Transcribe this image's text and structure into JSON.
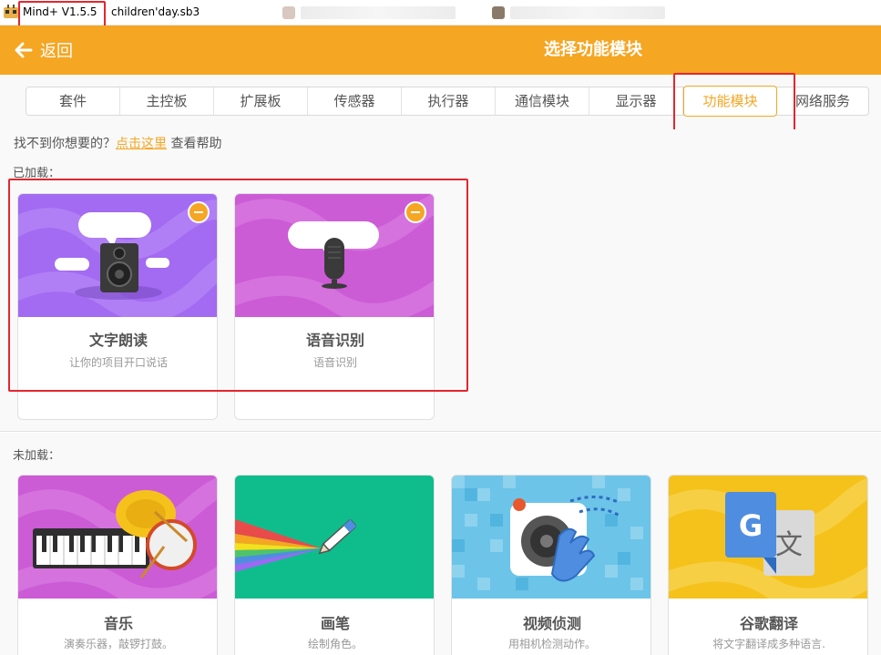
{
  "window": {
    "app_name": "Mind+ V1.5.5",
    "file_name": "children'day.sb3"
  },
  "header": {
    "back_label": "返回",
    "title": "选择功能模块"
  },
  "tabs": [
    {
      "label": "套件"
    },
    {
      "label": "主控板"
    },
    {
      "label": "扩展板"
    },
    {
      "label": "传感器"
    },
    {
      "label": "执行器"
    },
    {
      "label": "通信模块"
    },
    {
      "label": "显示器"
    },
    {
      "label": "功能模块",
      "active": true
    },
    {
      "label": "网络服务"
    }
  ],
  "help": {
    "prefix": "找不到你想要的？",
    "link": "点击这里",
    "suffix": "查看帮助"
  },
  "loaded": {
    "label": "已加载：",
    "cards": [
      {
        "title": "文字朗读",
        "desc": "让你的项目开口说话",
        "icon": "speaker-icon",
        "color": "#a36af2"
      },
      {
        "title": "语音识别",
        "desc": "语音识别",
        "icon": "microphone-icon",
        "color": "#cc5bd6"
      }
    ]
  },
  "unloaded": {
    "label": "未加载：",
    "cards": [
      {
        "title": "音乐",
        "desc": "演奏乐器，敲锣打鼓。",
        "icon": "music-icon",
        "color": "#cc5bd6"
      },
      {
        "title": "画笔",
        "desc": "绘制角色。",
        "icon": "pen-icon",
        "color": "#0fbd8c"
      },
      {
        "title": "视频侦测",
        "desc": "用相机检测动作。",
        "icon": "video-sensing-icon",
        "color": "#4fb3e0"
      },
      {
        "title": "谷歌翻译",
        "desc": "将文字翻译成多种语言.",
        "icon": "translate-icon",
        "color": "#f5c21b"
      }
    ]
  }
}
